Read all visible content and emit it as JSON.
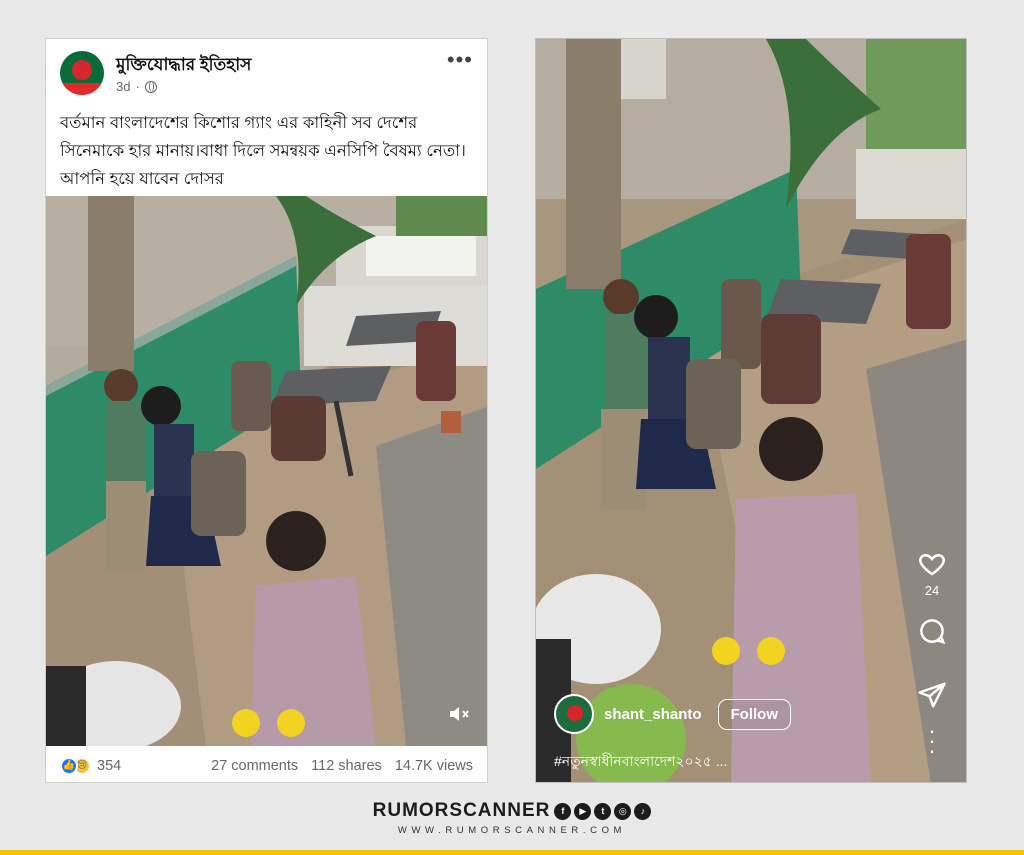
{
  "facebook_post": {
    "page_name": "মুক্তিযোদ্ধার ইতিহাস",
    "time": "3d",
    "post_text": "বর্তমান বাংলাদেশের কিশোর গ্যাং এর কাহিনী সব দেশের সিনেমাকে হার মানায়।বাধা দিলে সমন্বয়ক এনসিপি বৈষম্য নেতা। আপনি হয়ে যাবেন দোসর",
    "reactions_count": "354",
    "comments": "27 comments",
    "shares": "112 shares",
    "views": "14.7K views",
    "icons": [
      "more-options-icon",
      "globe-icon",
      "mute-icon",
      "like-icon",
      "sad-icon"
    ]
  },
  "instagram_reel": {
    "likes_count": "24",
    "username": "shant_shanto",
    "follow_label": "Follow",
    "caption": "#নতুনস্বাধীনবাংলাদেশ২০২৫ ...",
    "icons": [
      "heart-icon",
      "comment-icon",
      "share-icon",
      "more-icon"
    ]
  },
  "branding": {
    "name": "RUMORSCANNER",
    "url": "WWW.RUMORSCANNER.COM",
    "social_icons": [
      "facebook-icon",
      "youtube-icon",
      "twitter-icon",
      "instagram-icon",
      "tiktok-icon"
    ],
    "accent_color": "#f5c400"
  }
}
